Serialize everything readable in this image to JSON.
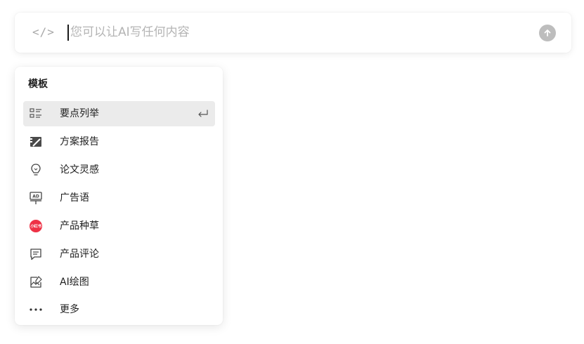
{
  "prompt": {
    "code_icon_text": "</>",
    "placeholder": "您可以让AI写任何内容",
    "value": ""
  },
  "menu": {
    "title": "模板",
    "items": [
      {
        "label": "要点列举",
        "icon": "list-bullets-icon",
        "active": true
      },
      {
        "label": "方案报告",
        "icon": "report-pencil-icon",
        "active": false
      },
      {
        "label": "论文灵感",
        "icon": "lightbulb-icon",
        "active": false
      },
      {
        "label": "广告语",
        "icon": "ad-board-icon",
        "active": false
      },
      {
        "label": "产品种草",
        "icon": "xiaohongshu-icon",
        "active": false
      },
      {
        "label": "产品评论",
        "icon": "comment-icon",
        "active": false
      },
      {
        "label": "AI绘图",
        "icon": "image-brush-icon",
        "active": false
      },
      {
        "label": "更多",
        "icon": "more-dots-icon",
        "active": false
      }
    ],
    "xhs_badge_text": "小红书"
  },
  "colors": {
    "accent_red": "#ee3145",
    "active_bg": "#ebebeb",
    "icon_gray": "#555555",
    "placeholder_gray": "#b4b4b4",
    "send_button_gray": "#bdbdbd"
  }
}
